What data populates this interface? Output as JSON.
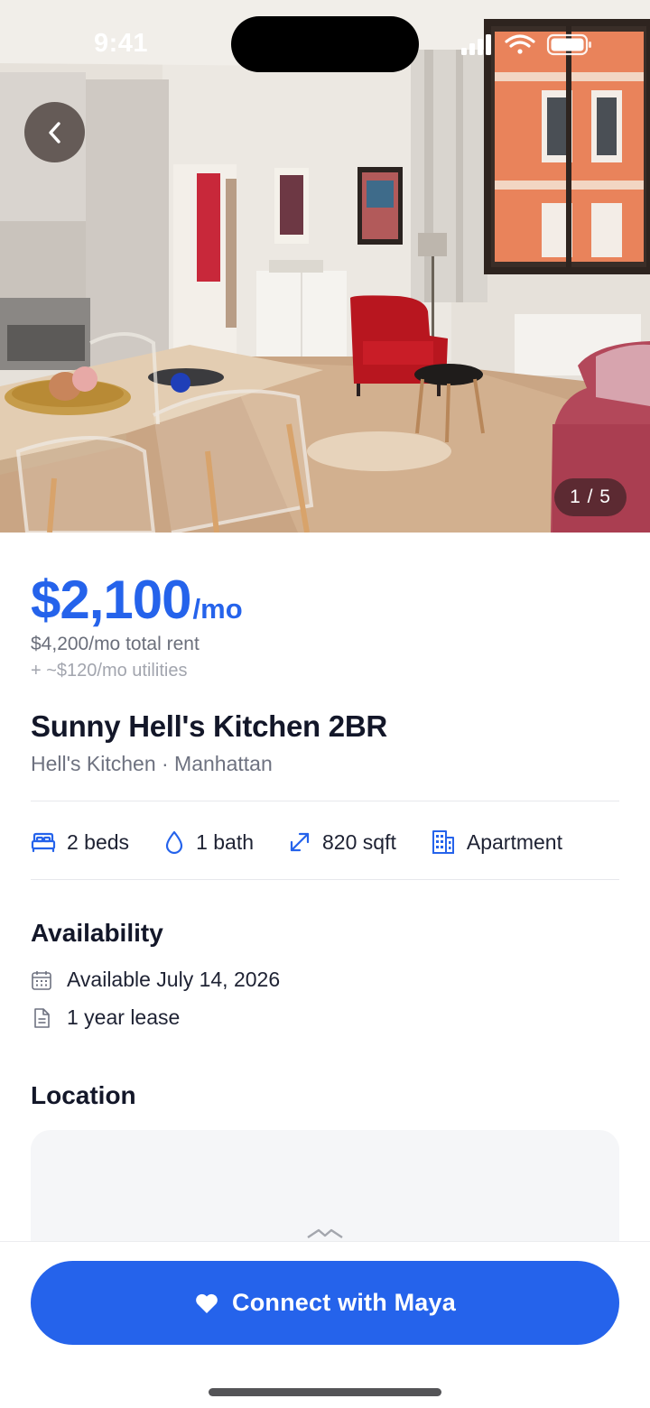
{
  "status_bar": {
    "time": "9:41"
  },
  "hero": {
    "photo_counter": "1 / 5"
  },
  "listing": {
    "price": "$2,100",
    "price_unit": "/mo",
    "total_rent": "$4,200/mo total rent",
    "utilities": "+ ~$120/mo utilities",
    "title": "Sunny Hell's Kitchen 2BR",
    "location": "Hell's Kitchen · Manhattan"
  },
  "specs": [
    {
      "icon": "bed-icon",
      "label": "2 beds"
    },
    {
      "icon": "water-drop-icon",
      "label": "1 bath"
    },
    {
      "icon": "expand-arrow-icon",
      "label": "820 sqft"
    },
    {
      "icon": "building-icon",
      "label": "Apartment"
    }
  ],
  "availability": {
    "title": "Availability",
    "date": "Available July 14, 2026",
    "lease": "1 year lease"
  },
  "location_section": {
    "title": "Location"
  },
  "cta": {
    "label": "Connect with Maya",
    "icon": "heart-icon"
  },
  "colors": {
    "accent": "#2563eb",
    "text": "#151a2e",
    "muted": "#6e7280"
  }
}
